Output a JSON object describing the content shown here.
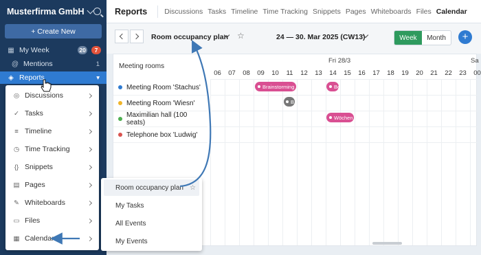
{
  "sidebar": {
    "org_name": "Musterfirma GmbH",
    "create_label": "+ Create New",
    "my_week": {
      "label": "My Week",
      "badge_gray": "20",
      "badge_red": "7"
    },
    "mentions": {
      "label": "Mentions",
      "count": "1"
    },
    "reports": {
      "label": "Reports"
    }
  },
  "reports_menu": {
    "items": [
      {
        "label": "Discussions",
        "icon": "discussions-icon"
      },
      {
        "label": "Tasks",
        "icon": "tasks-icon"
      },
      {
        "label": "Timeline",
        "icon": "timeline-icon"
      },
      {
        "label": "Time Tracking",
        "icon": "time-tracking-icon"
      },
      {
        "label": "Snippets",
        "icon": "snippets-icon"
      },
      {
        "label": "Pages",
        "icon": "pages-icon"
      },
      {
        "label": "Whiteboards",
        "icon": "whiteboards-icon"
      },
      {
        "label": "Files",
        "icon": "files-icon"
      },
      {
        "label": "Calendar",
        "icon": "calendar-icon"
      }
    ]
  },
  "calendar_submenu": {
    "items": [
      "Room occupancy plan",
      "My Tasks",
      "All Events",
      "My Events"
    ]
  },
  "topbar": {
    "title": "Reports",
    "tabs": [
      "Discussions",
      "Tasks",
      "Timeline",
      "Time Tracking",
      "Snippets",
      "Pages",
      "Whiteboards",
      "Files",
      "Calendar"
    ],
    "active_tab": "Calendar"
  },
  "toolbar": {
    "plan_title": "Room occupancy plan",
    "week_label": "24 — 30. Mar 2025 (CW13)",
    "view_week": "Week",
    "view_month": "Month",
    "add_label": "+"
  },
  "calendar": {
    "rooms_header": "Meeting rooms",
    "rooms": [
      {
        "name": "Meeting Room 'Stachus'",
        "color": "#2f7bd1"
      },
      {
        "name": "Meeting Room 'Wiesn'",
        "color": "#f0b429"
      },
      {
        "name": "Maximilian hall (100 seats)",
        "color": "#4caf50"
      },
      {
        "name": "Telephone box 'Ludwig'",
        "color": "#d9534f"
      }
    ],
    "day_label": "Fri 28/3",
    "next_day_label": "Sa",
    "hours": [
      "06",
      "07",
      "08",
      "09",
      "10",
      "11",
      "12",
      "13",
      "14",
      "15",
      "16",
      "17",
      "18",
      "19",
      "20",
      "21",
      "22",
      "23",
      "00"
    ],
    "events": [
      {
        "label": "Brainstorming",
        "room": 0
      },
      {
        "label": "Be",
        "room": 0
      },
      {
        "label": "B",
        "room": 1
      },
      {
        "label": "Wöchen",
        "room": 2
      }
    ]
  },
  "colors": {
    "sidebar": "#1c3a5e",
    "accent": "#2f7bd1",
    "week_active": "#2e9a5e",
    "event": "#d94f92"
  }
}
